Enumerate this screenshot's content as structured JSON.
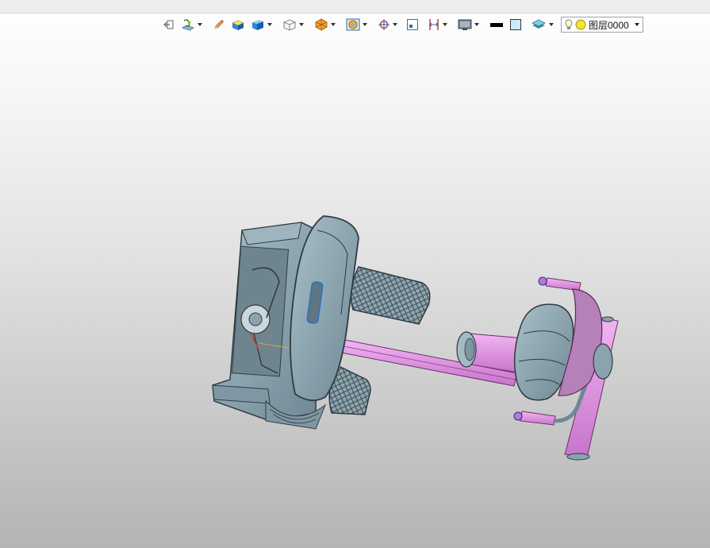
{
  "toolbar": {
    "tools": [
      {
        "name": "exit-sketch-icon",
        "caret": false
      },
      {
        "name": "sketch-plane-icon",
        "caret": true
      },
      {
        "name": "pencil-icon",
        "caret": false
      },
      {
        "name": "extrude-icon",
        "caret": false
      },
      {
        "name": "solid-box-icon",
        "caret": true
      },
      {
        "name": "view-orientation-icon",
        "caret": true
      },
      {
        "name": "render-style-icon",
        "caret": true
      },
      {
        "name": "section-view-icon",
        "caret": true
      },
      {
        "name": "snap-target-icon",
        "caret": true
      },
      {
        "name": "frame-icon",
        "caret": false
      },
      {
        "name": "dimension-icon",
        "caret": true
      },
      {
        "name": "monitor-icon",
        "caret": true
      },
      {
        "name": "line-color-icon",
        "caret": false
      },
      {
        "name": "fill-color-icon",
        "caret": false
      },
      {
        "name": "layer-stack-icon",
        "caret": true
      }
    ],
    "layer": {
      "label": "图层0000"
    }
  },
  "colors": {
    "model_gray": "#8aa3ae",
    "model_dark": "#3d4b53",
    "model_pink": "#dd8fdf",
    "accent_blue": "#1f6fd1"
  }
}
